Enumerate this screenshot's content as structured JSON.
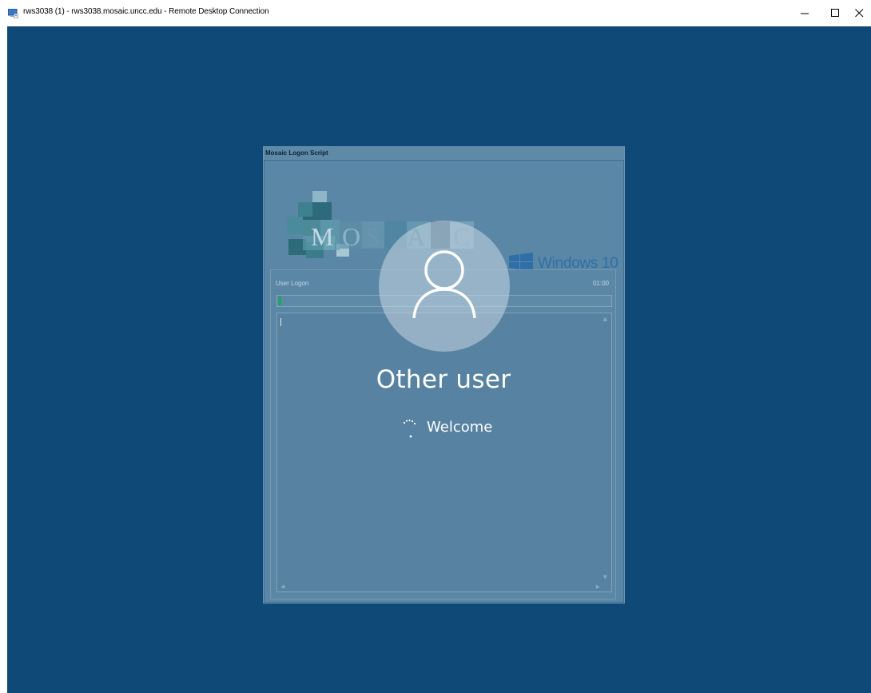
{
  "window": {
    "title": "rws3038 (1) - rws3038.mosaic.uncc.edu - Remote Desktop Connection",
    "controls": {
      "minimize": "minimize",
      "maximize": "maximize",
      "close": "close"
    }
  },
  "logon_script": {
    "title": "Mosaic Logon Script",
    "brand_letters": [
      "M",
      "O",
      "S",
      "A",
      "I",
      "C"
    ],
    "os_label": "Windows 10",
    "section_label": "User Logon",
    "elapsed": "01:00",
    "progress_percent": 1
  },
  "lock_screen": {
    "user_name": "Other user",
    "status": "Welcome"
  },
  "colors": {
    "desktop": "#0e4978",
    "progress": "#27a06a"
  }
}
